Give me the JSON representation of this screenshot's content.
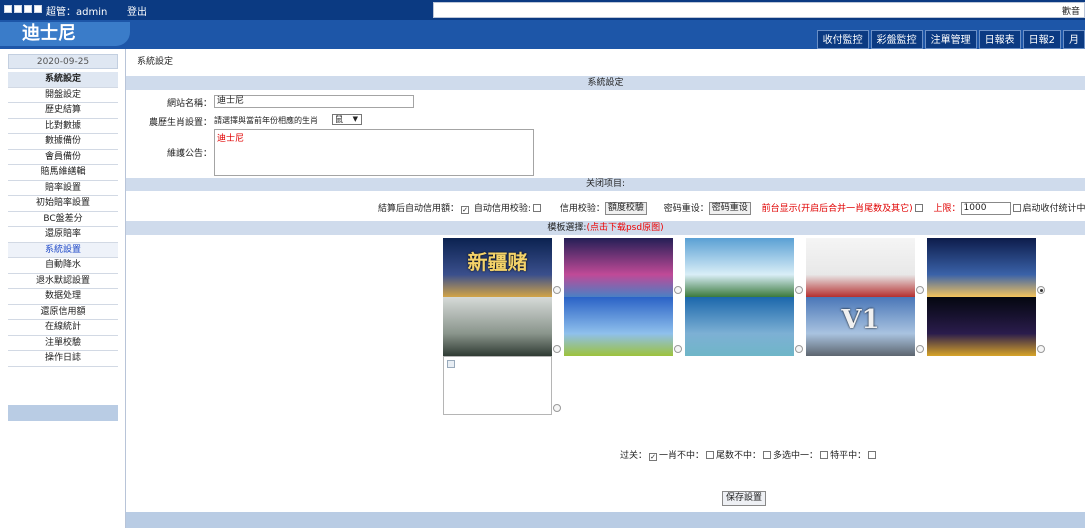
{
  "topbar": {
    "user_text": "超管：admin",
    "logout": "登出",
    "ticker_text": "歡音"
  },
  "logo": {
    "text": "迪士尼"
  },
  "topnav": [
    "收付監控",
    "彩盤監控",
    "注單管理",
    "日報表",
    "日報2",
    "月"
  ],
  "sidebar": {
    "date": "2020-09-25",
    "items": [
      "系統設定",
      "開盤設定",
      "歷史結算",
      "比對數據",
      "數據備份",
      "會員備份",
      "賠馬維繕輯",
      "賠率設置",
      "初始賠率設置",
      "BC盤差分",
      "還原賠率",
      "系統設置",
      "自動降水",
      "退水默認設置",
      "数据处理",
      "還原信用額",
      "在線統計",
      "注單校驗",
      "操作日誌"
    ],
    "active_index": 11
  },
  "breadcrumb": "系統設定",
  "section1": {
    "title": "系統設定",
    "site_name_label": "網站名稱：",
    "site_name_value": "迪士尼",
    "zodiac_label": "農歷生肖設置：",
    "zodiac_hint": "請選擇與當前年份相應的生肖",
    "zodiac_value": "鼠",
    "notice_label": "維護公告：",
    "notice_value": "迪士尼"
  },
  "section2": {
    "title": "关闭项目:",
    "auto_credit": "結算后自动信用額：",
    "auto_credit_check": "自动信用校验:",
    "credit_check": "信用校验：",
    "credit_check_btn": "額度校驗",
    "pwd_reset": "密码重设：",
    "pwd_reset_btn": "密码重设",
    "front_show": "前台显示(开启后合并一肖尾数及其它)",
    "limit_label": "上限：",
    "limit_value": "1000",
    "auto_text": "启动收付统计中奖黄色标"
  },
  "section3": {
    "title": "模板選擇:",
    "link": "(点击下载psd原图)",
    "selected_index": 4
  },
  "templates": [
    {
      "name": "新疆赌",
      "colors": [
        "#0b2250",
        "#3a4f8c",
        "#d2a447"
      ]
    },
    {
      "name": "",
      "colors": [
        "#241f56",
        "#c04a97",
        "#4a80c4"
      ]
    },
    {
      "name": "",
      "colors": [
        "#5aa0d4",
        "#d9eef7",
        "#3b7a3d"
      ]
    },
    {
      "name": "",
      "colors": [
        "#f5f5f5",
        "#e8e8e8",
        "#b53030"
      ]
    },
    {
      "name": "",
      "colors": [
        "#0d1c4b",
        "#3a62a8",
        "#f2c35c"
      ]
    },
    {
      "name": "",
      "colors": [
        "#d6dad8",
        "#8a958c",
        "#2f3b33"
      ]
    },
    {
      "name": "",
      "colors": [
        "#2a62c6",
        "#8fc0ec",
        "#9dc23c"
      ]
    },
    {
      "name": "",
      "colors": [
        "#1b67ac",
        "#7db0d4",
        "#6fb6c8"
      ]
    },
    {
      "name": "V1",
      "colors": [
        "#4a77b8",
        "#a9c3e0",
        "#5d6670"
      ]
    },
    {
      "name": "",
      "colors": [
        "#040710",
        "#2a1c4c",
        "#d7a428"
      ]
    },
    {
      "name": "",
      "colors": [
        "#ffffff",
        "#ffffff",
        "#ffffff"
      ]
    }
  ],
  "guoguan": {
    "label": "过关：",
    "opts": [
      "一肖不中：",
      "尾数不中：",
      "多选中一：",
      "特平中："
    ],
    "checked": [
      true,
      false,
      false,
      false
    ]
  },
  "save_label": "保存設置"
}
